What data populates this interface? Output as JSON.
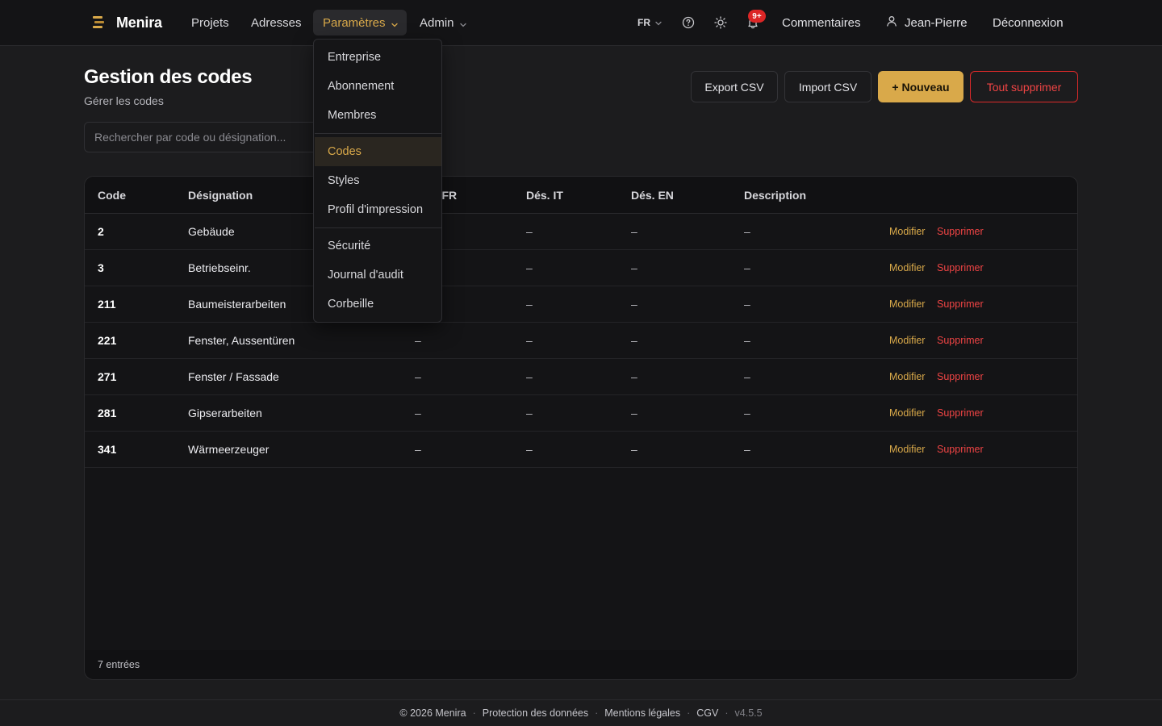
{
  "app": {
    "name": "Menira"
  },
  "nav": {
    "projects": "Projets",
    "addresses": "Adresses",
    "settings": "Paramètres",
    "admin": "Admin"
  },
  "topright": {
    "lang": "FR",
    "notifications_badge": "9+",
    "comments": "Commentaires",
    "user": "Jean-Pierre",
    "logout": "Déconnexion"
  },
  "page": {
    "title": "Gestion des codes",
    "subtitle": "Gérer les codes"
  },
  "actions": {
    "export": "Export CSV",
    "import": "Import CSV",
    "new": "+ Nouveau",
    "delete_all": "Tout supprimer"
  },
  "search": {
    "placeholder": "Rechercher par code ou désignation..."
  },
  "table": {
    "columns": [
      "Code",
      "Désignation",
      "Dés. FR",
      "Dés. IT",
      "Dés. EN",
      "Description"
    ],
    "edit_label": "Modifier",
    "delete_label": "Supprimer",
    "rows": [
      {
        "code": "2",
        "designation": "Gebäude",
        "fr": "–",
        "it": "–",
        "en": "–",
        "description": "–"
      },
      {
        "code": "3",
        "designation": "Betriebseinr.",
        "fr": "–",
        "it": "–",
        "en": "–",
        "description": "–"
      },
      {
        "code": "211",
        "designation": "Baumeisterarbeiten",
        "fr": "–",
        "it": "–",
        "en": "–",
        "description": "–"
      },
      {
        "code": "221",
        "designation": "Fenster, Aussentüren",
        "fr": "–",
        "it": "–",
        "en": "–",
        "description": "–"
      },
      {
        "code": "271",
        "designation": "Fenster / Fassade",
        "fr": "–",
        "it": "–",
        "en": "–",
        "description": "–"
      },
      {
        "code": "281",
        "designation": "Gipserarbeiten",
        "fr": "–",
        "it": "–",
        "en": "–",
        "description": "–"
      },
      {
        "code": "341",
        "designation": "Wärmeerzeuger",
        "fr": "–",
        "it": "–",
        "en": "–",
        "description": "–"
      }
    ],
    "footer": "7 entrées"
  },
  "dropdown": {
    "items": [
      "Entreprise",
      "Abonnement",
      "Membres",
      "Codes",
      "Styles",
      "Profil d'impression",
      "Sécurité",
      "Journal d'audit",
      "Corbeille"
    ],
    "active": "Codes"
  },
  "footer": {
    "copyright": "© 2026 Menira",
    "privacy": "Protection des données",
    "legal": "Mentions légales",
    "terms": "CGV",
    "version": "v4.5.5",
    "separator": "·"
  },
  "colors": {
    "accent": "#d9a94a",
    "danger": "#ef4444",
    "background": "#1c1c1e",
    "topbar": "#141416"
  },
  "icons": {
    "brand": "stack-logo-icon",
    "help": "help-circle-icon",
    "theme": "sun-icon",
    "notifications": "bell-icon",
    "user": "user-icon",
    "chevron": "chevron-down-icon"
  }
}
